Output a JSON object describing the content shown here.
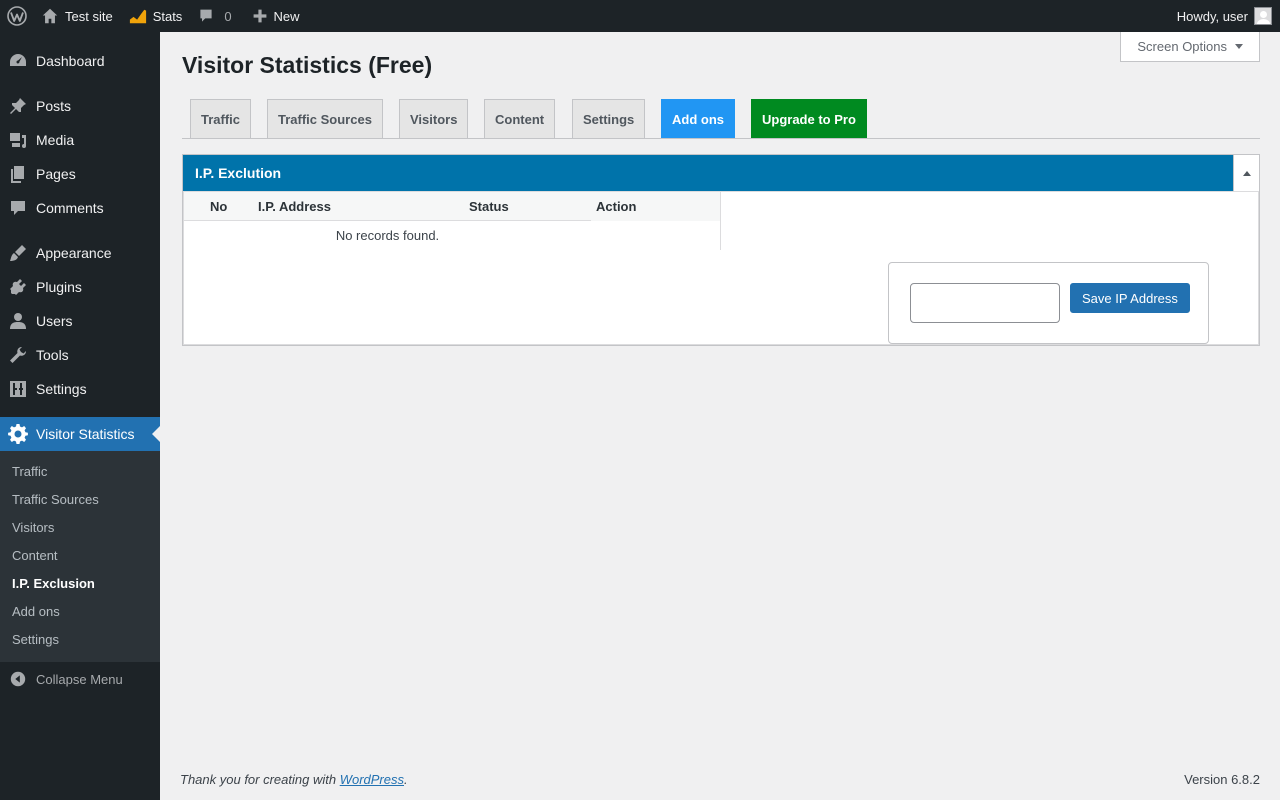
{
  "adminbar": {
    "site_name": "Test site",
    "stats_label": "Stats",
    "comments_count": "0",
    "new_label": "New",
    "howdy": "Howdy, user"
  },
  "sidebar": {
    "items": [
      {
        "label": "Dashboard",
        "icon": "dashboard-icon"
      },
      {
        "label": "Posts",
        "icon": "pin-icon"
      },
      {
        "label": "Media",
        "icon": "media-icon"
      },
      {
        "label": "Pages",
        "icon": "pages-icon"
      },
      {
        "label": "Comments",
        "icon": "comment-icon"
      },
      {
        "label": "Appearance",
        "icon": "paintbrush-icon"
      },
      {
        "label": "Plugins",
        "icon": "plugin-icon"
      },
      {
        "label": "Users",
        "icon": "user-icon"
      },
      {
        "label": "Tools",
        "icon": "wrench-icon"
      },
      {
        "label": "Settings",
        "icon": "settings-sliders-icon"
      },
      {
        "label": "Visitor Statistics",
        "icon": "gear-icon"
      }
    ],
    "submenu": [
      "Traffic",
      "Traffic Sources",
      "Visitors",
      "Content",
      "I.P. Exclusion",
      "Add ons",
      "Settings"
    ],
    "collapse_label": "Collapse Menu"
  },
  "page": {
    "screen_options": "Screen Options",
    "title": "Visitor Statistics (Free)",
    "tabs": [
      "Traffic",
      "Traffic Sources",
      "Visitors",
      "Content",
      "Settings",
      "Add ons",
      "Upgrade to Pro"
    ]
  },
  "panel": {
    "title": "I.P. Exclution",
    "columns": [
      "No",
      "I.P. Address",
      "Status",
      "Action"
    ],
    "empty_text": "No records found.",
    "ip_input_value": "",
    "save_label": "Save IP Address"
  },
  "footer": {
    "thanks_prefix": "Thank you for creating with ",
    "thanks_link": "WordPress",
    "thanks_suffix": ".",
    "version": "Version 6.8.2"
  },
  "colors": {
    "adminbar_bg": "#1d2327",
    "accent": "#2271b1",
    "panel_header": "#0073aa",
    "addons_tab": "#2196f3",
    "upgrade_tab": "#008a20"
  }
}
